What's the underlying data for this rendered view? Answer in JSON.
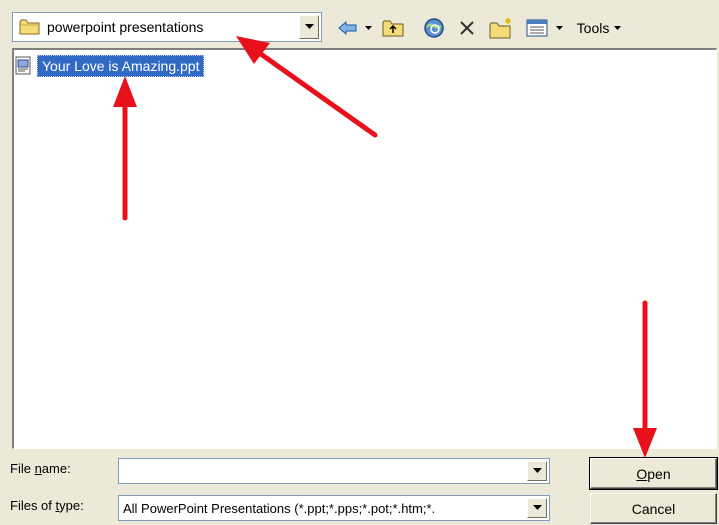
{
  "toolbar": {
    "look_in_value": "powerpoint presentations",
    "look_in_icon": "folder-icon",
    "tools_label": "Tools",
    "icons": [
      "back-arrow-icon",
      "up-one-level-icon",
      "search-web-icon",
      "delete-icon",
      "new-folder-icon",
      "views-icon"
    ]
  },
  "file_list": {
    "items": [
      {
        "name": "Your Love is Amazing.ppt",
        "icon": "powerpoint-file-icon",
        "selected": true
      }
    ]
  },
  "form": {
    "file_name_label_pre": "File ",
    "file_name_label_accel": "n",
    "file_name_label_post": "ame:",
    "file_name_value": "",
    "files_of_type_label_pre": "Files of ",
    "files_of_type_label_accel": "t",
    "files_of_type_label_post": "ype:",
    "files_of_type_value": "All PowerPoint Presentations (*.ppt;*.pps;*.pot;*.htm;*."
  },
  "buttons": {
    "open_accel": "O",
    "open_rest": "pen",
    "cancel": "Cancel"
  },
  "colors": {
    "selection": "#316ac5",
    "annotation_arrow": "#e8101a",
    "dialog_background": "#ece9d8"
  }
}
